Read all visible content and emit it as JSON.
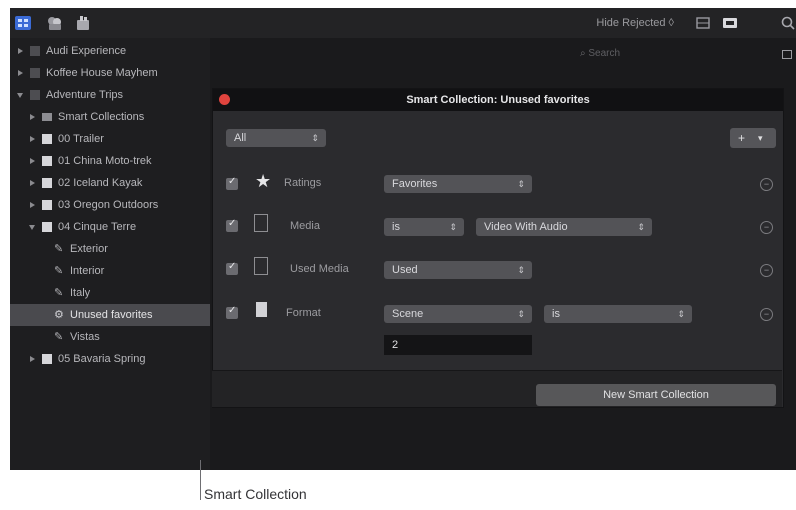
{
  "toolbar": {
    "hide_rejected_label": "Hide Rejected ◊",
    "icons": [
      "library-icon",
      "photos-icon",
      "titles-icon",
      "filmstrip-icon",
      "clip-icon",
      "search-icon"
    ]
  },
  "sidebar": {
    "items": [
      {
        "label": "Audi Experience",
        "icon": "library-icon",
        "expanded": false
      },
      {
        "label": "Koffee House Mayhem",
        "icon": "library-icon",
        "expanded": false
      },
      {
        "label": "Adventure Trips",
        "icon": "library-icon",
        "expanded": true
      },
      {
        "label": "Smart Collections",
        "icon": "folder-icon",
        "expanded": false
      },
      {
        "label": "00 Trailer",
        "icon": "event-icon",
        "expanded": false
      },
      {
        "label": "01 China Moto-trek",
        "icon": "event-icon",
        "expanded": false
      },
      {
        "label": "02 Iceland Kayak",
        "icon": "event-icon",
        "expanded": false
      },
      {
        "label": "03 Oregon Outdoors",
        "icon": "event-icon",
        "expanded": false
      },
      {
        "label": "04 Cinque Terre",
        "icon": "event-icon",
        "expanded": true
      },
      {
        "label": "Exterior",
        "icon": "keyword-icon"
      },
      {
        "label": "Interior",
        "icon": "keyword-icon"
      },
      {
        "label": "Italy",
        "icon": "keyword-icon"
      },
      {
        "label": "Unused favorites",
        "icon": "smart-collection-icon",
        "selected": true
      },
      {
        "label": "Vistas",
        "icon": "keyword-icon"
      },
      {
        "label": "05 Bavaria Spring",
        "icon": "event-icon",
        "expanded": false
      }
    ]
  },
  "browser": {
    "search_placeholder": "Search"
  },
  "dialog": {
    "title": "Smart Collection: Unused favorites",
    "match_popup": "All",
    "rules": [
      {
        "label": "Ratings",
        "icon": "star-icon",
        "values": [
          "Favorites"
        ]
      },
      {
        "label": "Media",
        "icon": "media-icon",
        "values": [
          "is",
          "Video With Audio"
        ]
      },
      {
        "label": "Used Media",
        "icon": "used-media-icon",
        "values": [
          "Used"
        ]
      },
      {
        "label": "Format",
        "icon": "format-icon",
        "values": [
          "Scene",
          "is"
        ],
        "field": "2"
      }
    ],
    "new_button": "New Smart Collection"
  },
  "callout": {
    "label": "Smart Collection"
  },
  "colors": {
    "close": "#e0443e",
    "accent": "#3b6bd6"
  }
}
